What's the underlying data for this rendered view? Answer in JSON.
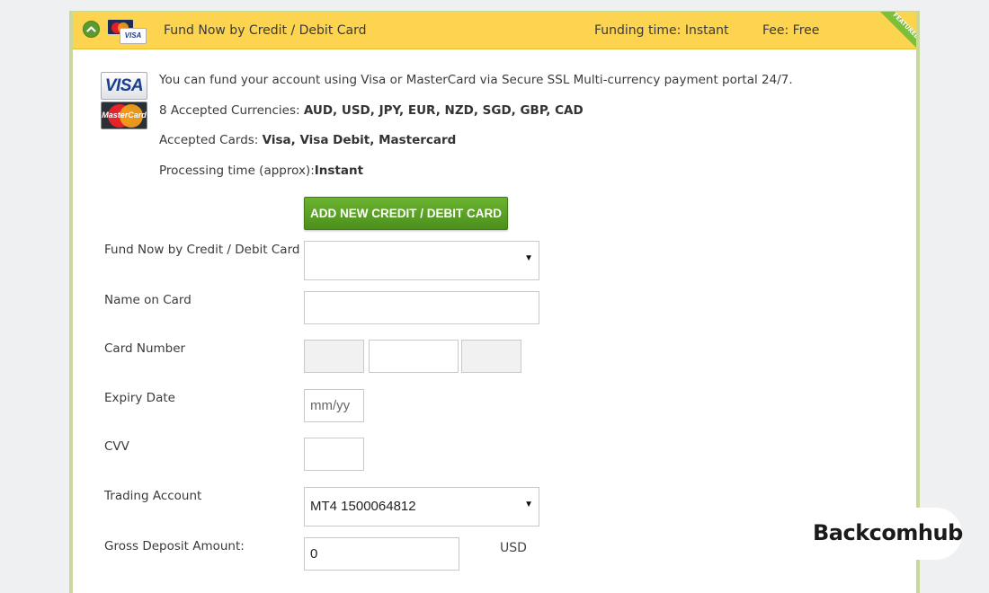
{
  "header": {
    "title": "Fund Now by Credit / Debit Card",
    "funding_time": "Funding time: Instant",
    "fee": "Fee: Free",
    "ribbon": "FEATURED",
    "visa_mini_text": "VISA"
  },
  "logos": {
    "visa_text": "VISA",
    "mastercard_text": "MasterCard"
  },
  "info": {
    "line1": "You can fund your account using Visa or MasterCard via Secure SSL Multi-currency payment portal 24/7.",
    "currencies_label": "8 Accepted Currencies: ",
    "currencies_value": "AUD, USD, JPY, EUR, NZD, SGD, GBP, CAD",
    "cards_label": "Accepted Cards: ",
    "cards_value": "Visa, Visa Debit, Mastercard",
    "processing_label": "Processing time (approx):",
    "processing_value": "Instant"
  },
  "add_card_button": "ADD NEW CREDIT / DEBIT CARD",
  "form": {
    "fund_card_label": "Fund Now by Credit / Debit Card",
    "fund_card_value": "",
    "name_label": "Name on Card",
    "name_value": "",
    "card_number_label": "Card Number",
    "expiry_label": "Expiry Date",
    "expiry_placeholder": "mm/yy",
    "cvv_label": "CVV",
    "trading_account_label": "Trading Account",
    "trading_account_value": "MT4 1500064812",
    "gross_deposit_label": "Gross Deposit Amount:",
    "gross_deposit_value": "0",
    "currency": "USD"
  },
  "watermark": "Backcomhub",
  "colors": {
    "header_bg": "#fcd450",
    "button_green": "#5aa126",
    "panel_border": "#c8d89a"
  },
  "icons": [
    "chevron-up-icon",
    "mastercard-icon",
    "visa-icon",
    "dropdown-arrow-icon"
  ]
}
